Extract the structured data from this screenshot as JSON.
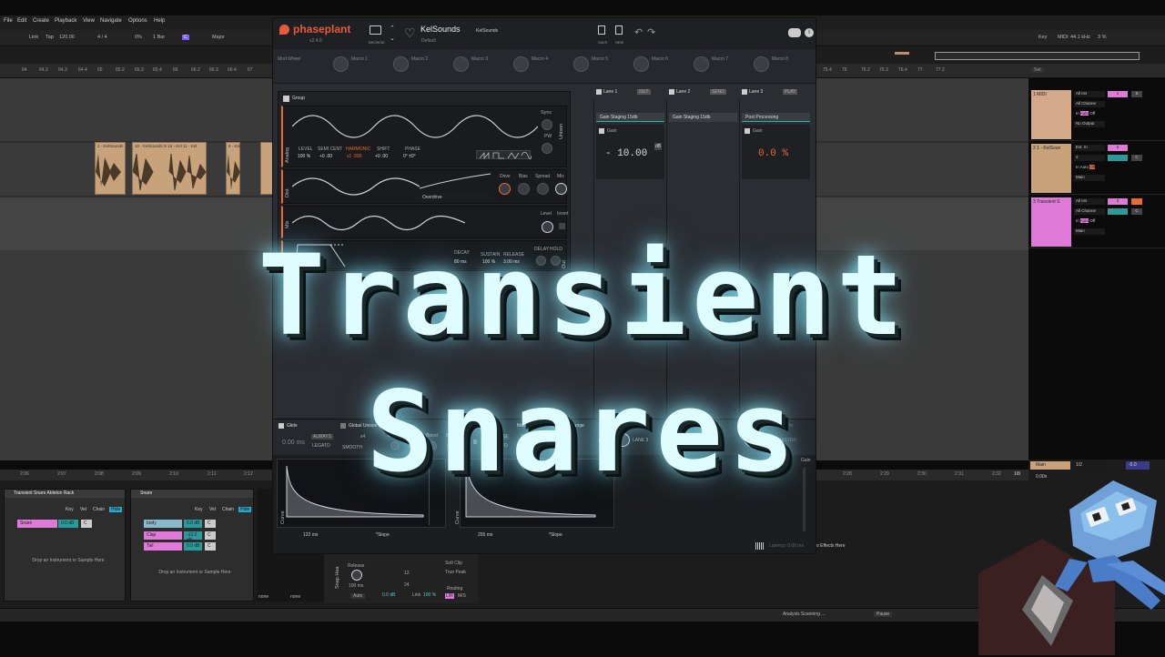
{
  "menubar": {
    "items": [
      "File",
      "Edit",
      "Create",
      "Playback",
      "View",
      "Navigate",
      "Options",
      "Help"
    ]
  },
  "transport": {
    "link": "Link",
    "tap": "Tap",
    "tempo": "120.00",
    "signature": "4 / 4",
    "metronome": "0%",
    "quantize": "1 Bar",
    "key": "C",
    "scale": "Major",
    "right_key": "Key",
    "right_midi": "MIDI",
    "sample_rate": "44.1 kHz",
    "cpu": "3 %"
  },
  "ruler": {
    "ticks_left": [
      "64",
      "64.2",
      "64.3",
      "64.4",
      "65",
      "65.2",
      "65.3",
      "65.4",
      "66",
      "66.2",
      "66.3",
      "66.4",
      "67"
    ],
    "ticks_right": [
      "75.4",
      "76",
      "76.2",
      "76.3",
      "76.4",
      "77",
      "77.2"
    ],
    "set_label": "Set"
  },
  "clips": [
    "1 - KelSounds",
    "10 - KelSounds S 16 - Kel 11 - Kel",
    "8 - Kel"
  ],
  "tracks": [
    {
      "name": "1 MIDI",
      "input": "All Ins",
      "channel": "All Channe",
      "monitor": [
        "In",
        "Auto",
        "Off"
      ],
      "output": "No Output",
      "number": "1",
      "color": "#d4a98a"
    },
    {
      "name": "2 1 - KelSoun",
      "input": "Ext. In",
      "channel": "2",
      "monitor": [
        "In",
        "Auto",
        "Off"
      ],
      "output": "Main",
      "number": "2",
      "color": "#c8a27a"
    },
    {
      "name": "3 Transient S",
      "input": "All Ins",
      "channel": "All Channe",
      "monitor": [
        "In",
        "Auto",
        "Off"
      ],
      "output": "Main",
      "number": "3",
      "color": "#e07ad8"
    }
  ],
  "phaseplant": {
    "logo": "phaseplant",
    "version": "v2.4.0",
    "browse": "BROWSE",
    "preset": "KelSounds",
    "preset_sub": "Default",
    "author": "KelSounds",
    "save": "SAVE",
    "new": "NEW",
    "macros": [
      "Mod Wheel",
      "Macro 1",
      "Macro 2",
      "Macro 3",
      "Macro 4",
      "Macro 5",
      "Macro 6",
      "Macro 7",
      "Macro 8"
    ],
    "group": "Group",
    "analog": {
      "label": "Analog",
      "level": "LEVEL",
      "level_val": "100 %",
      "semi": "SEMI CENT",
      "semi_val": "+0 .00",
      "harmonic": "HARMONIC",
      "harmonic_val": "x1 .000",
      "shift": "SHIFT",
      "shift_val": "+0 .00",
      "phase": "PHASE",
      "phase_val": "0° ±0°",
      "sync": "Sync",
      "pw": "PW",
      "unison": "Unison"
    },
    "dist": {
      "label": "Dist",
      "mode": "Overdrive",
      "drive": "Drive",
      "bias": "Bias",
      "spread": "Spread",
      "mix": "Mix"
    },
    "mix": {
      "label": "Mix",
      "level": "Level",
      "invert": "Invert"
    },
    "env": {
      "label": "Env",
      "decay": "DECAY",
      "decay_val": "80 ms",
      "sustain": "SUSTAIN",
      "sustain_val": "100 %",
      "release": "RELEASE",
      "release_val": "3.00 ms",
      "delay": "DELAY",
      "hold": "HOLD",
      "out": "Out"
    },
    "lanes": [
      "Lane 1",
      "Lane 2",
      "Lane 3"
    ],
    "lane_tags": [
      "OUT",
      "SEND",
      "PLAY"
    ],
    "fx": [
      "Gain Staging 15db",
      "Gain Staging 15db",
      "Post Processing"
    ],
    "gain_label": "Gain",
    "gain1": "- 10.00",
    "gain1_unit": "dB",
    "gain2": "0.0 %",
    "bottom": {
      "glide": "Glide",
      "glide_val": "0.00 ms",
      "always": "ALWAYS",
      "legato": "LEGATO",
      "global_unison": "Global Unison",
      "unison_voices": "x4",
      "smooth": "SMOOTH",
      "detune": "Detune",
      "spread": "Spread",
      "blend": "Blend",
      "bias": "Bias",
      "polyphony": "Polyphony",
      "poly_val": "8",
      "retrig": "RETRIG",
      "legato2": "LEGATO",
      "master_pitch": "Master pitch",
      "semis_cents": "SEMIS CENTS",
      "pitch_val": "+0  00",
      "bend_range": "Bend Range",
      "bend_val": "2",
      "gain": "Gain",
      "mix": "Mix",
      "send_to": "Send to",
      "lane3": "LANE 3",
      "master": "MASTER"
    },
    "curves": [
      {
        "label": "Curve",
        "time": "122 ms",
        "slope": "*Slope"
      },
      {
        "label": "Curve",
        "time": "255 ms",
        "slope": "*Slope"
      }
    ],
    "latency": "Latency: 0.00 ms",
    "gain_right": "Gain"
  },
  "bottom_ruler": [
    "2:06",
    "2:07",
    "2:08",
    "2:09",
    "2:10",
    "2:11",
    "2:12",
    "2:28",
    "2:29",
    "2:30",
    "2:31",
    "2:32"
  ],
  "page_indicator": "1/8",
  "rack1": {
    "title": "Transient Snare Ableton Rack",
    "key": "Key",
    "vel": "Vel",
    "chain": "Chain",
    "hide": "Hide",
    "chain_name": "Snare",
    "chain_val": "0.0 dB",
    "chain_pan": "C",
    "drop": "Drop an Instrument or Sample Here"
  },
  "rack2": {
    "title": "Snare",
    "key": "Key",
    "vel": "Vel",
    "chain": "Chain",
    "hide": "Hide",
    "chains": [
      {
        "name": "body",
        "val": "0.0 dB",
        "pan": "C"
      },
      {
        "name": "Clap",
        "val": "-13.0 dB",
        "pan": "C"
      },
      {
        "name": "Tail",
        "val": "0.0 dB",
        "pan": "C"
      }
    ],
    "drop": "Drop an Instrument or Sample Here"
  },
  "drum_bus": {
    "release": "Release",
    "release_val": "100 ms",
    "auto": "Auto",
    "gain_val": "0.0 dB",
    "link": "Link",
    "link_val": "100 %",
    "soft_clip": "Soft Clip",
    "true_peak": "True Peak",
    "routing": "Routing",
    "lr": "L/R",
    "ms": "M/S",
    "nums": [
      "12",
      "24"
    ],
    "none1": "none",
    "none2": "none",
    "snap": "Snap Hea"
  },
  "right_panel": {
    "main": "Main",
    "main_page": "1/2",
    "main_val": "-5.0",
    "zoom": "0.00x",
    "drop_fx": "o Effects Here"
  },
  "status": {
    "analysis": "Analysis Scanning ...",
    "pause": "Pause"
  },
  "title": "Transient Snares"
}
